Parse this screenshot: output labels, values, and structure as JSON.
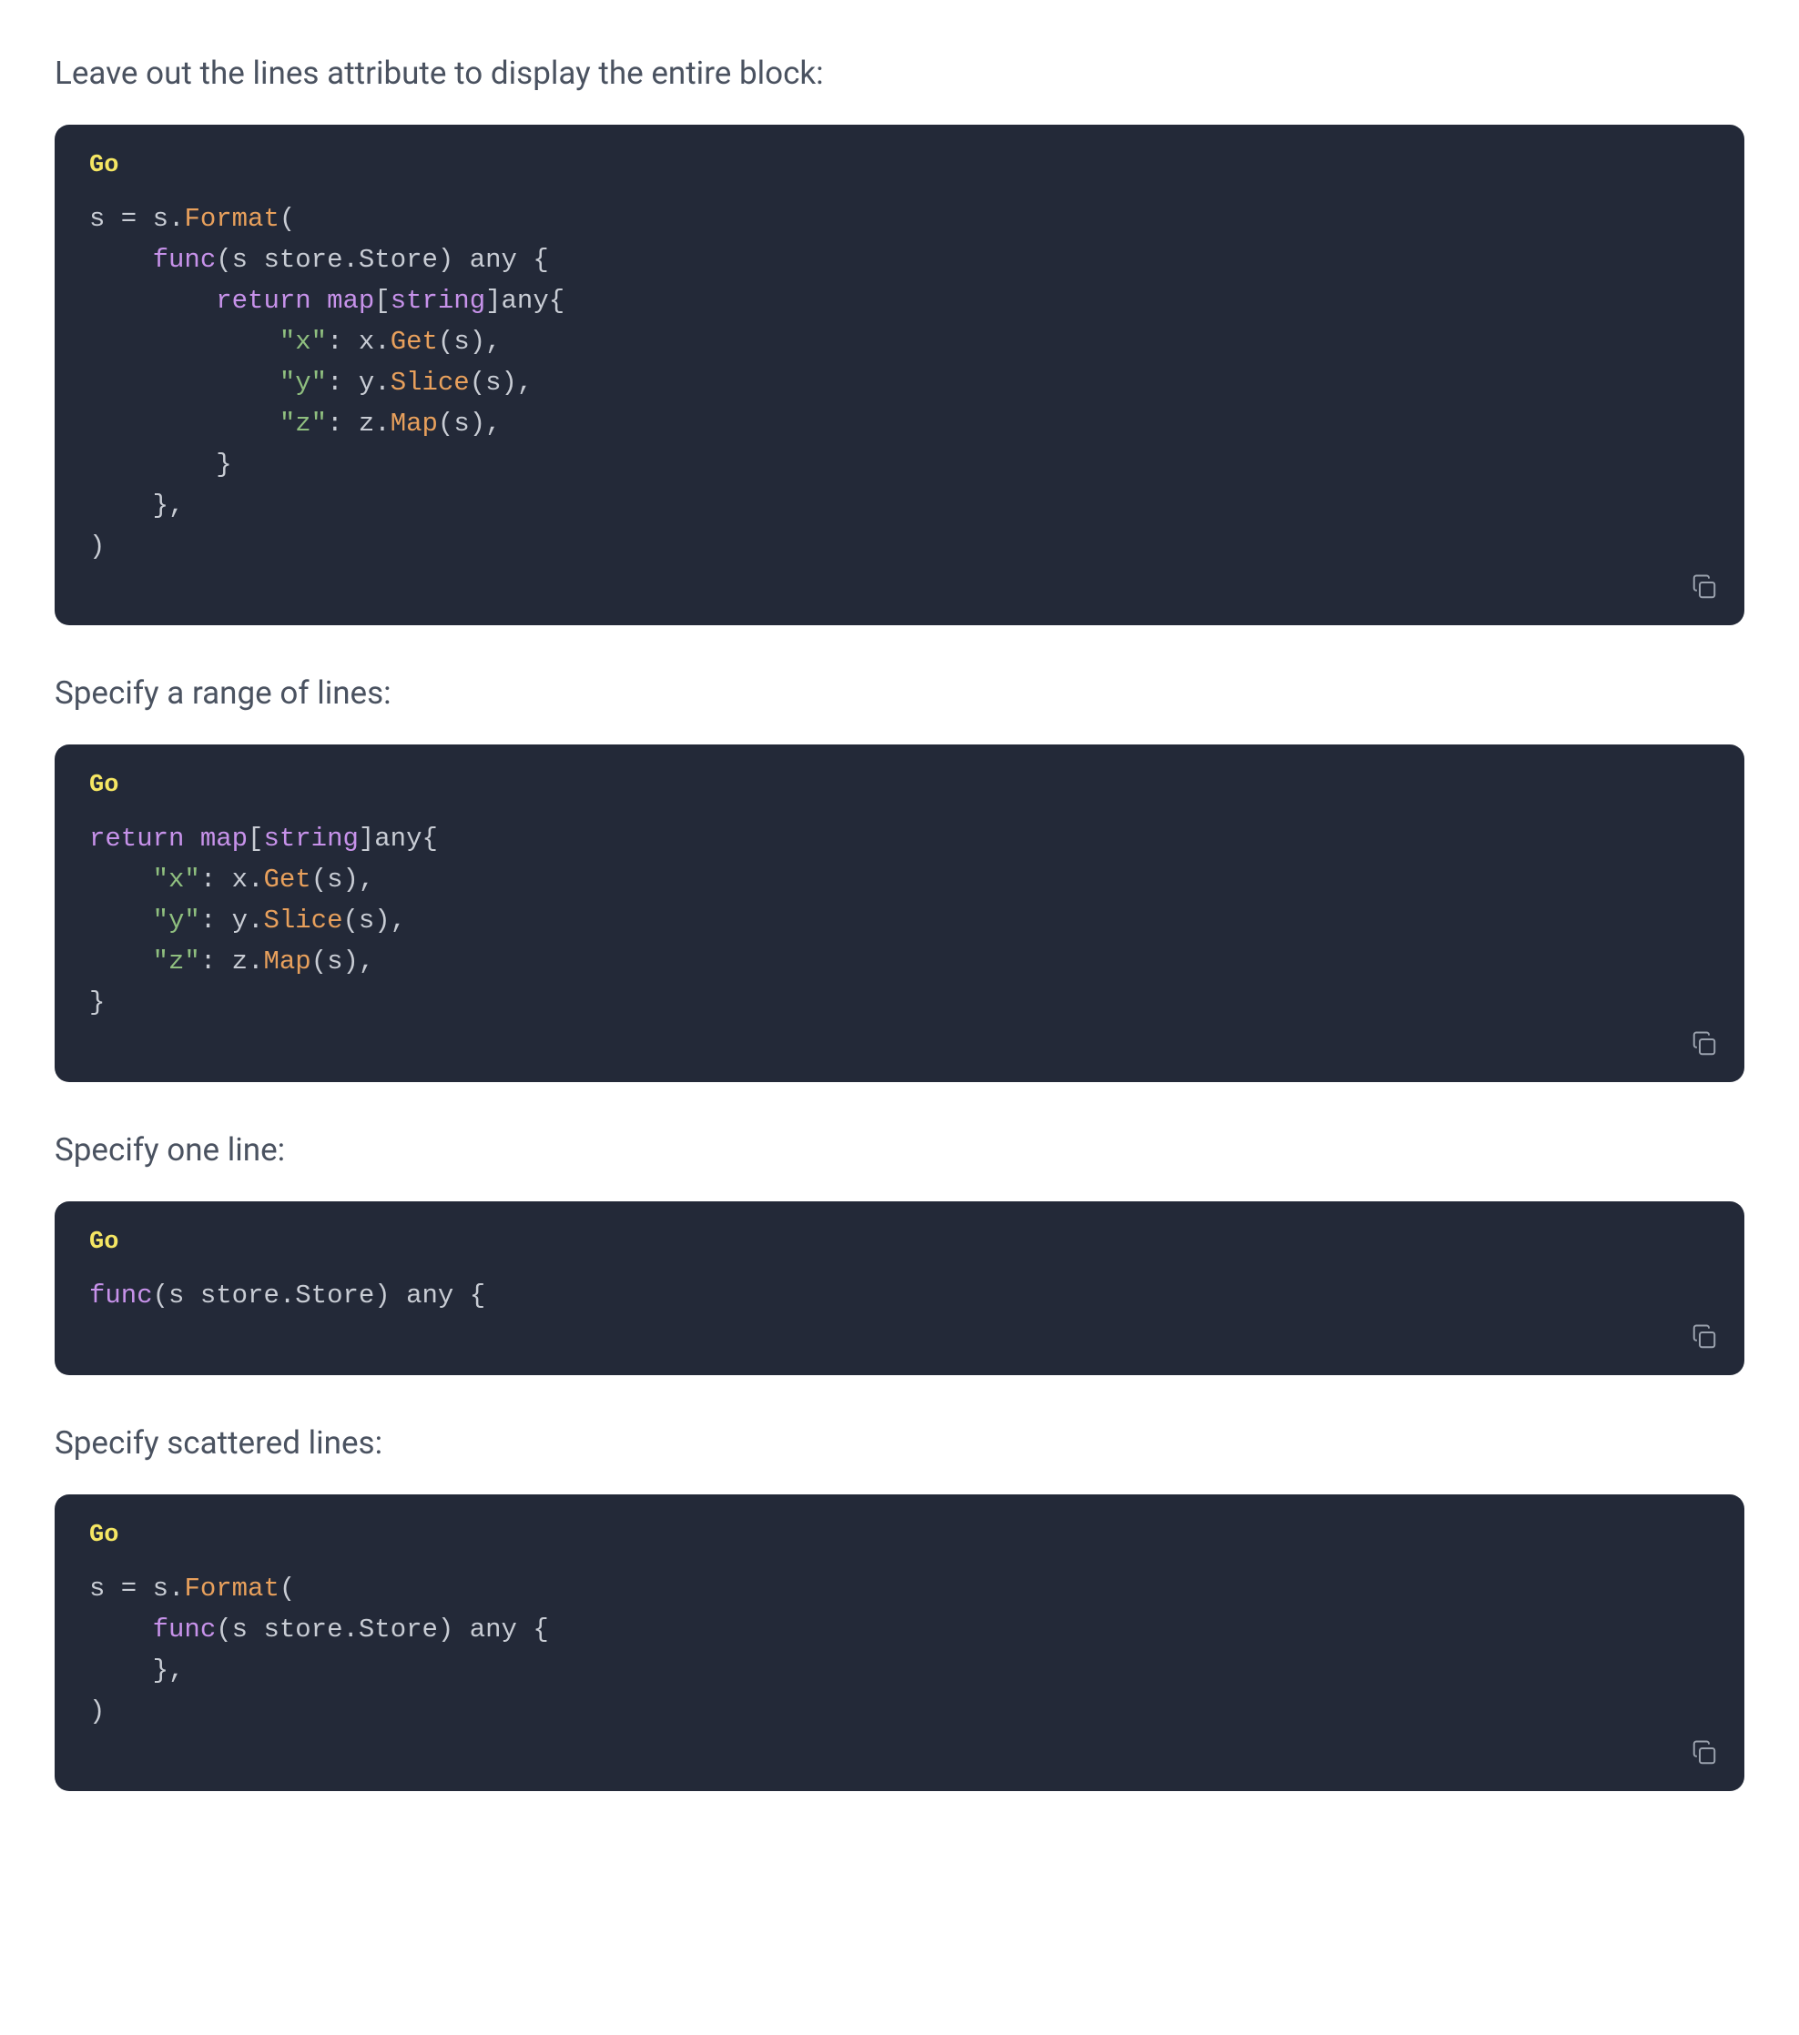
{
  "sections": [
    {
      "intro": "Leave out the lines attribute to display the entire block:",
      "lang": "Go",
      "code_tokens": [
        [
          [
            "id",
            "s"
          ],
          [
            "op",
            " = "
          ],
          [
            "id",
            "s"
          ],
          [
            "punc",
            "."
          ],
          [
            "fn",
            "Format"
          ],
          [
            "punc",
            "("
          ]
        ],
        [
          [
            "punc",
            "    "
          ],
          [
            "kw",
            "func"
          ],
          [
            "punc",
            "("
          ],
          [
            "id",
            "s"
          ],
          [
            "punc",
            " "
          ],
          [
            "id",
            "store"
          ],
          [
            "punc",
            "."
          ],
          [
            "id",
            "Store"
          ],
          [
            "punc",
            ") "
          ],
          [
            "id",
            "any"
          ],
          [
            "punc",
            " {"
          ]
        ],
        [
          [
            "punc",
            "        "
          ],
          [
            "kw",
            "return"
          ],
          [
            "punc",
            " "
          ],
          [
            "kw",
            "map"
          ],
          [
            "punc",
            "["
          ],
          [
            "type",
            "string"
          ],
          [
            "punc",
            "]"
          ],
          [
            "id",
            "any"
          ],
          [
            "punc",
            "{"
          ]
        ],
        [
          [
            "punc",
            "            "
          ],
          [
            "str",
            "\"x\""
          ],
          [
            "punc",
            ": "
          ],
          [
            "id",
            "x"
          ],
          [
            "punc",
            "."
          ],
          [
            "fn",
            "Get"
          ],
          [
            "punc",
            "("
          ],
          [
            "id",
            "s"
          ],
          [
            "punc",
            "),"
          ]
        ],
        [
          [
            "punc",
            "            "
          ],
          [
            "str",
            "\"y\""
          ],
          [
            "punc",
            ": "
          ],
          [
            "id",
            "y"
          ],
          [
            "punc",
            "."
          ],
          [
            "fn",
            "Slice"
          ],
          [
            "punc",
            "("
          ],
          [
            "id",
            "s"
          ],
          [
            "punc",
            "),"
          ]
        ],
        [
          [
            "punc",
            "            "
          ],
          [
            "str",
            "\"z\""
          ],
          [
            "punc",
            ": "
          ],
          [
            "id",
            "z"
          ],
          [
            "punc",
            "."
          ],
          [
            "fn",
            "Map"
          ],
          [
            "punc",
            "("
          ],
          [
            "id",
            "s"
          ],
          [
            "punc",
            "),"
          ]
        ],
        [
          [
            "punc",
            "        }"
          ]
        ],
        [
          [
            "punc",
            "    },"
          ]
        ],
        [
          [
            "punc",
            ")"
          ]
        ]
      ]
    },
    {
      "intro": "Specify a range of lines:",
      "lang": "Go",
      "code_tokens": [
        [
          [
            "kw",
            "return"
          ],
          [
            "punc",
            " "
          ],
          [
            "kw",
            "map"
          ],
          [
            "punc",
            "["
          ],
          [
            "type",
            "string"
          ],
          [
            "punc",
            "]"
          ],
          [
            "id",
            "any"
          ],
          [
            "punc",
            "{"
          ]
        ],
        [
          [
            "punc",
            "    "
          ],
          [
            "str",
            "\"x\""
          ],
          [
            "punc",
            ": "
          ],
          [
            "id",
            "x"
          ],
          [
            "punc",
            "."
          ],
          [
            "fn",
            "Get"
          ],
          [
            "punc",
            "("
          ],
          [
            "id",
            "s"
          ],
          [
            "punc",
            "),"
          ]
        ],
        [
          [
            "punc",
            "    "
          ],
          [
            "str",
            "\"y\""
          ],
          [
            "punc",
            ": "
          ],
          [
            "id",
            "y"
          ],
          [
            "punc",
            "."
          ],
          [
            "fn",
            "Slice"
          ],
          [
            "punc",
            "("
          ],
          [
            "id",
            "s"
          ],
          [
            "punc",
            "),"
          ]
        ],
        [
          [
            "punc",
            "    "
          ],
          [
            "str",
            "\"z\""
          ],
          [
            "punc",
            ": "
          ],
          [
            "id",
            "z"
          ],
          [
            "punc",
            "."
          ],
          [
            "fn",
            "Map"
          ],
          [
            "punc",
            "("
          ],
          [
            "id",
            "s"
          ],
          [
            "punc",
            "),"
          ]
        ],
        [
          [
            "punc",
            "}"
          ]
        ]
      ]
    },
    {
      "intro": "Specify one line:",
      "lang": "Go",
      "code_tokens": [
        [
          [
            "kw",
            "func"
          ],
          [
            "punc",
            "("
          ],
          [
            "id",
            "s"
          ],
          [
            "punc",
            " "
          ],
          [
            "id",
            "store"
          ],
          [
            "punc",
            "."
          ],
          [
            "id",
            "Store"
          ],
          [
            "punc",
            ") "
          ],
          [
            "id",
            "any"
          ],
          [
            "punc",
            " {"
          ]
        ]
      ]
    },
    {
      "intro": "Specify scattered lines:",
      "lang": "Go",
      "code_tokens": [
        [
          [
            "id",
            "s"
          ],
          [
            "op",
            " = "
          ],
          [
            "id",
            "s"
          ],
          [
            "punc",
            "."
          ],
          [
            "fn",
            "Format"
          ],
          [
            "punc",
            "("
          ]
        ],
        [
          [
            "punc",
            "    "
          ],
          [
            "kw",
            "func"
          ],
          [
            "punc",
            "("
          ],
          [
            "id",
            "s"
          ],
          [
            "punc",
            " "
          ],
          [
            "id",
            "store"
          ],
          [
            "punc",
            "."
          ],
          [
            "id",
            "Store"
          ],
          [
            "punc",
            ") "
          ],
          [
            "id",
            "any"
          ],
          [
            "punc",
            " {"
          ]
        ],
        [
          [
            "punc",
            "    },"
          ]
        ],
        [
          [
            "punc",
            ")"
          ]
        ]
      ]
    }
  ]
}
